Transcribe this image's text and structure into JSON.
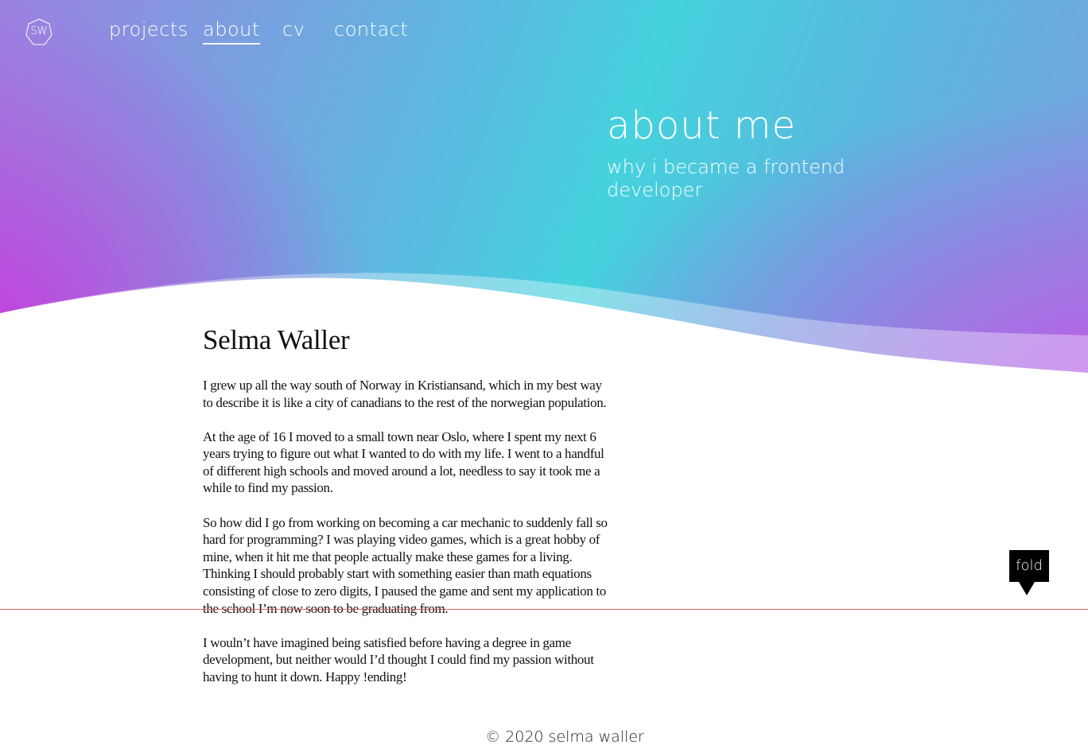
{
  "logo": {
    "text": "SW"
  },
  "nav": {
    "items": [
      {
        "label": "projects"
      },
      {
        "label": "about",
        "active": true
      },
      {
        "label": "cv"
      },
      {
        "label": "contact"
      }
    ]
  },
  "hero": {
    "title": "about me",
    "subtitle": "why i became a frontend developer"
  },
  "article": {
    "heading": "Selma Waller",
    "paragraphs": [
      "I grew up all the way south of Norway in Kristiansand, which in my best way to describe it is like a city of canadians to the rest of the norwegian population.",
      "At the age of 16 I moved to a small town near Oslo, where I spent my next 6 years trying to figure out what I wanted to do with my life. I went to a handful of different high schools and moved around a lot, needless to say it took me a while to find my passion.",
      "So how did I go from working on becoming a car mechanic to suddenly fall so hard for programming? I was playing video games, which is a great hobby of mine, when it hit me that people actually make these games for a living. Thinking I should probably start with something easier than math equations consisting of close to zero digits, I paused the game and sent my application to the school I’m now soon to be graduating from.",
      "I wouln’t have imagined being satisfied before having a degree in game development, but neither would I’d thought I could find my passion without having to hunt it down. Happy !ending!"
    ]
  },
  "footer": {
    "text": "© 2020 selma waller"
  },
  "fold": {
    "label": "fold"
  },
  "colors": {
    "accent_purple": "#c040dc",
    "accent_cyan": "#45d2de",
    "fold_line": "#e06060"
  }
}
